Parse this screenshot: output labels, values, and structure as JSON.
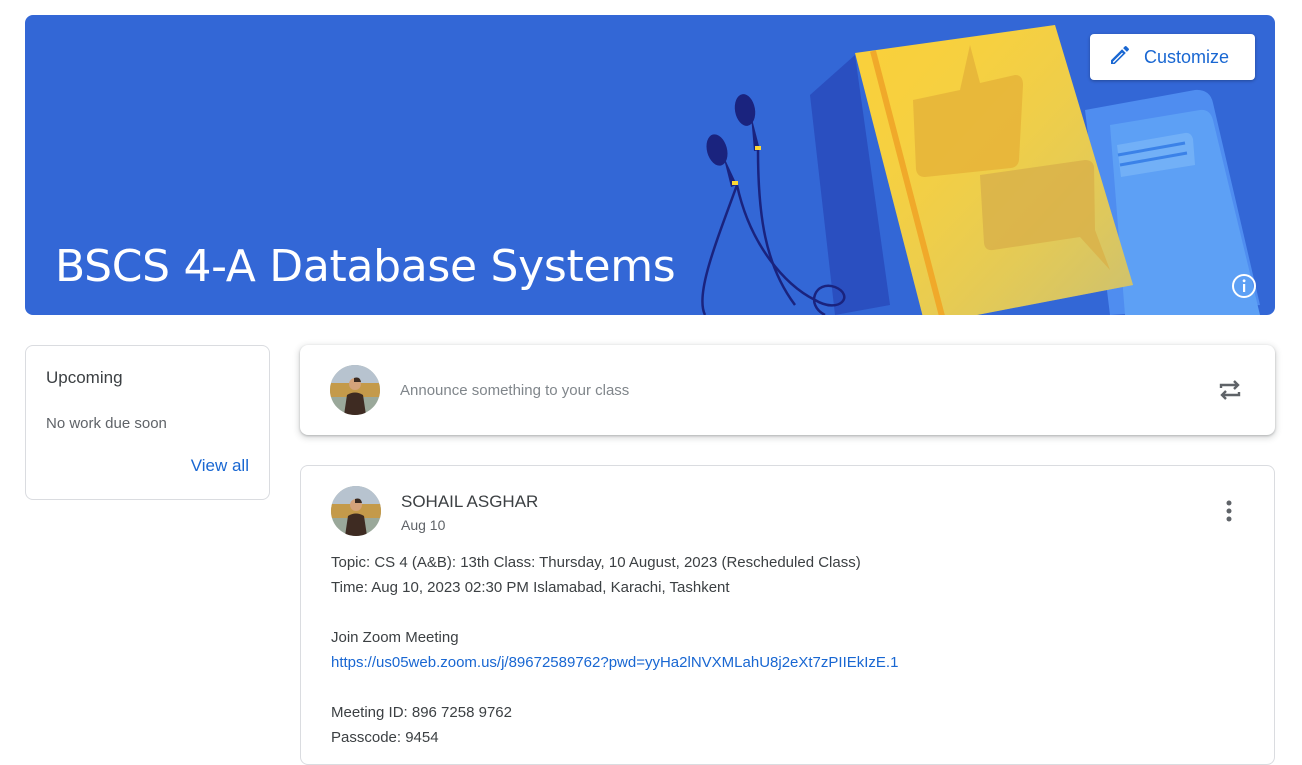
{
  "banner": {
    "title": "BSCS 4-A Database Systems",
    "customize_label": "Customize",
    "colors": {
      "background": "#3367d6",
      "book": "#fdd835",
      "accent": "#1967d2"
    }
  },
  "upcoming": {
    "title": "Upcoming",
    "empty_text": "No work due soon",
    "view_all": "View all"
  },
  "announce": {
    "placeholder": "Announce something to your class"
  },
  "post": {
    "author": "SOHAIL ASGHAR",
    "date": "Aug 10",
    "lines": {
      "topic": "Topic: CS 4 (A&B): 13th Class: Thursday, 10 August, 2023 (Rescheduled Class)",
      "time": "Time: Aug 10, 2023 02:30 PM Islamabad, Karachi, Tashkent",
      "join": "Join Zoom Meeting",
      "link": "https://us05web.zoom.us/j/89672589762?pwd=yyHa2lNVXMLahU8j2eXt7zPIIEkIzE.1",
      "meeting_id": "Meeting ID: 896 7258 9762",
      "passcode": "Passcode: 9454"
    }
  },
  "icons": {
    "customize": "pencil-icon",
    "info": "info-icon",
    "repost": "repeat-icon",
    "more": "more-vert-icon"
  }
}
